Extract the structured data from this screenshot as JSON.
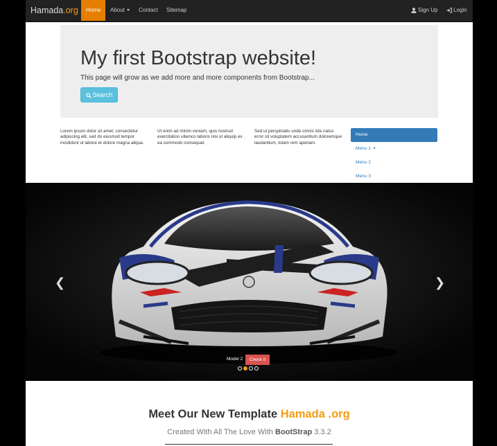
{
  "navbar": {
    "brand_main": "Hamada",
    "brand_suffix": ".org",
    "items": [
      "Home",
      "About",
      "Contact",
      "Sitemap"
    ],
    "signup_label": "Sign Up",
    "login_label": "Login"
  },
  "jumbotron": {
    "title": "My first Bootstrap website!",
    "text": "This page will grow as we add more and more components from Bootstrap...",
    "search_label": "Search"
  },
  "columns": [
    "Lorem ipsum dolor sit amet, consectetur adipiscing elit, sed do eiusmod tempor incididunt ut labore et dolore magna aliqua.",
    "Ut enim ad minim veniam, quis nostrud exercitation ullamco laboris nisi ut aliquip ex ea commodo consequat.",
    "Sed ut perspiciatis unde omnis iste natus error sit voluptatem accusantium doloremque laudantium, totam rem aperiam."
  ],
  "side_menu": [
    "Home",
    "Menu 1",
    "Menu 2",
    "Menu 3"
  ],
  "carousel": {
    "caption": "Model 2",
    "button_label": "Check it",
    "slide_count": 4,
    "active_index": 1
  },
  "footer": {
    "heading_main": "Meet Our New Template",
    "heading_accent": "Hamada .org",
    "sub_prefix": "Created With All The Love With",
    "sub_bold": "BootStrap",
    "sub_version": "3.3.2"
  },
  "colors": {
    "accent": "#f39c12",
    "primary": "#337ab7",
    "info": "#5bc0de",
    "danger": "#d9534f",
    "navbar": "#222222"
  },
  "icons": [
    "search-icon",
    "user-icon",
    "login-icon",
    "chevron-left-icon",
    "chevron-right-icon"
  ]
}
